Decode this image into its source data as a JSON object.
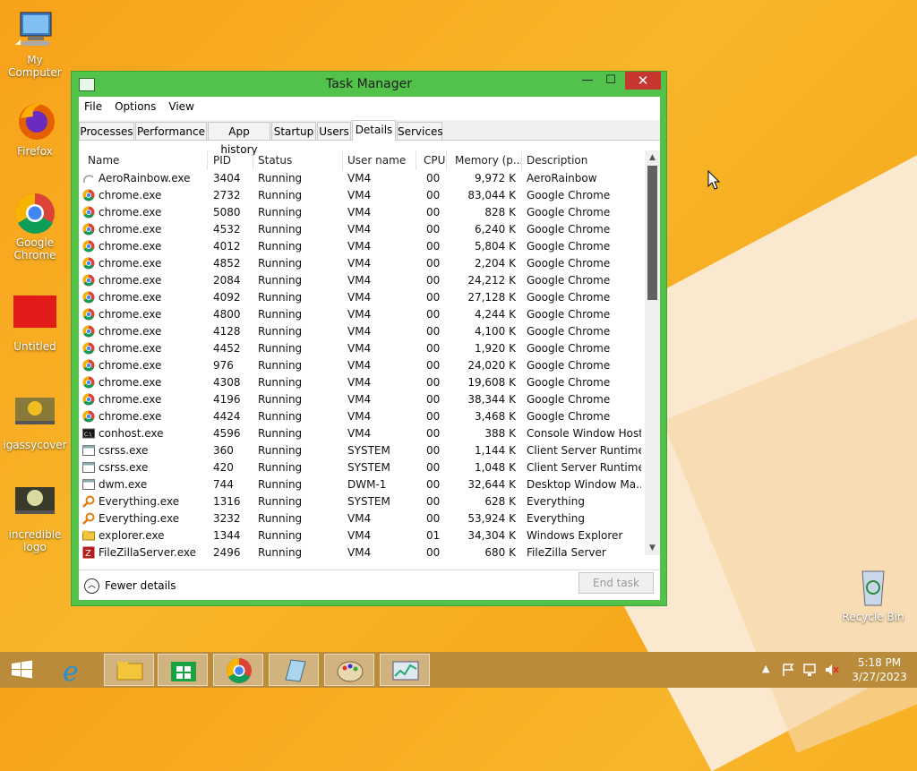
{
  "desktop": {
    "icons": [
      {
        "label": "My Computer",
        "icon": "computer-icon"
      },
      {
        "label": "Firefox",
        "icon": "firefox-icon"
      },
      {
        "label": "Google Chrome",
        "icon": "chrome-icon"
      },
      {
        "label": "Untitled",
        "icon": "red-image-icon"
      },
      {
        "label": "igassycover",
        "icon": "image-thumbnail-icon"
      },
      {
        "label": "incredible logo",
        "icon": "image-thumbnail-icon"
      },
      {
        "label": "Recycle Bin",
        "icon": "recycle-bin-icon"
      }
    ]
  },
  "window": {
    "title": "Task Manager",
    "min_glyph": "—",
    "max_glyph": "☐",
    "close_glyph": "✕",
    "menu": [
      "File",
      "Options",
      "View"
    ],
    "tabs": [
      "Processes",
      "Performance",
      "App history",
      "Startup",
      "Users",
      "Details",
      "Services"
    ],
    "active_tab": "Details",
    "columns": [
      "Name",
      "PID",
      "Status",
      "User name",
      "CPU",
      "Memory (p...",
      "Description"
    ],
    "sort_glyph": "^",
    "rows": [
      {
        "icon": "aero",
        "name": "AeroRainbow.exe",
        "pid": "3404",
        "status": "Running",
        "user": "VM4",
        "cpu": "00",
        "mem": "9,972 K",
        "desc": "AeroRainbow"
      },
      {
        "icon": "chrome",
        "name": "chrome.exe",
        "pid": "2732",
        "status": "Running",
        "user": "VM4",
        "cpu": "00",
        "mem": "83,044 K",
        "desc": "Google Chrome"
      },
      {
        "icon": "chrome",
        "name": "chrome.exe",
        "pid": "5080",
        "status": "Running",
        "user": "VM4",
        "cpu": "00",
        "mem": "828 K",
        "desc": "Google Chrome"
      },
      {
        "icon": "chrome",
        "name": "chrome.exe",
        "pid": "4532",
        "status": "Running",
        "user": "VM4",
        "cpu": "00",
        "mem": "6,240 K",
        "desc": "Google Chrome"
      },
      {
        "icon": "chrome",
        "name": "chrome.exe",
        "pid": "4012",
        "status": "Running",
        "user": "VM4",
        "cpu": "00",
        "mem": "5,804 K",
        "desc": "Google Chrome"
      },
      {
        "icon": "chrome",
        "name": "chrome.exe",
        "pid": "4852",
        "status": "Running",
        "user": "VM4",
        "cpu": "00",
        "mem": "2,204 K",
        "desc": "Google Chrome"
      },
      {
        "icon": "chrome",
        "name": "chrome.exe",
        "pid": "2084",
        "status": "Running",
        "user": "VM4",
        "cpu": "00",
        "mem": "24,212 K",
        "desc": "Google Chrome"
      },
      {
        "icon": "chrome",
        "name": "chrome.exe",
        "pid": "4092",
        "status": "Running",
        "user": "VM4",
        "cpu": "00",
        "mem": "27,128 K",
        "desc": "Google Chrome"
      },
      {
        "icon": "chrome",
        "name": "chrome.exe",
        "pid": "4800",
        "status": "Running",
        "user": "VM4",
        "cpu": "00",
        "mem": "4,244 K",
        "desc": "Google Chrome"
      },
      {
        "icon": "chrome",
        "name": "chrome.exe",
        "pid": "4128",
        "status": "Running",
        "user": "VM4",
        "cpu": "00",
        "mem": "4,100 K",
        "desc": "Google Chrome"
      },
      {
        "icon": "chrome",
        "name": "chrome.exe",
        "pid": "4452",
        "status": "Running",
        "user": "VM4",
        "cpu": "00",
        "mem": "1,920 K",
        "desc": "Google Chrome"
      },
      {
        "icon": "chrome",
        "name": "chrome.exe",
        "pid": "976",
        "status": "Running",
        "user": "VM4",
        "cpu": "00",
        "mem": "24,020 K",
        "desc": "Google Chrome"
      },
      {
        "icon": "chrome",
        "name": "chrome.exe",
        "pid": "4308",
        "status": "Running",
        "user": "VM4",
        "cpu": "00",
        "mem": "19,608 K",
        "desc": "Google Chrome"
      },
      {
        "icon": "chrome",
        "name": "chrome.exe",
        "pid": "4196",
        "status": "Running",
        "user": "VM4",
        "cpu": "00",
        "mem": "38,344 K",
        "desc": "Google Chrome"
      },
      {
        "icon": "chrome",
        "name": "chrome.exe",
        "pid": "4424",
        "status": "Running",
        "user": "VM4",
        "cpu": "00",
        "mem": "3,468 K",
        "desc": "Google Chrome"
      },
      {
        "icon": "console",
        "name": "conhost.exe",
        "pid": "4596",
        "status": "Running",
        "user": "VM4",
        "cpu": "00",
        "mem": "388 K",
        "desc": "Console Window Host"
      },
      {
        "icon": "window",
        "name": "csrss.exe",
        "pid": "360",
        "status": "Running",
        "user": "SYSTEM",
        "cpu": "00",
        "mem": "1,144 K",
        "desc": "Client Server Runtime..."
      },
      {
        "icon": "window",
        "name": "csrss.exe",
        "pid": "420",
        "status": "Running",
        "user": "SYSTEM",
        "cpu": "00",
        "mem": "1,048 K",
        "desc": "Client Server Runtime..."
      },
      {
        "icon": "window",
        "name": "dwm.exe",
        "pid": "744",
        "status": "Running",
        "user": "DWM-1",
        "cpu": "00",
        "mem": "32,644 K",
        "desc": "Desktop Window Ma..."
      },
      {
        "icon": "search",
        "name": "Everything.exe",
        "pid": "1316",
        "status": "Running",
        "user": "SYSTEM",
        "cpu": "00",
        "mem": "628 K",
        "desc": "Everything"
      },
      {
        "icon": "search",
        "name": "Everything.exe",
        "pid": "3232",
        "status": "Running",
        "user": "VM4",
        "cpu": "00",
        "mem": "53,924 K",
        "desc": "Everything"
      },
      {
        "icon": "explorer",
        "name": "explorer.exe",
        "pid": "1344",
        "status": "Running",
        "user": "VM4",
        "cpu": "01",
        "mem": "34,304 K",
        "desc": "Windows Explorer"
      },
      {
        "icon": "filezilla",
        "name": "FileZillaServer.exe",
        "pid": "2496",
        "status": "Running",
        "user": "VM4",
        "cpu": "00",
        "mem": "680 K",
        "desc": "FileZilla Server"
      }
    ],
    "fewer_details": "Fewer details",
    "end_task": "End task"
  },
  "taskbar": {
    "items": [
      "start-icon",
      "internet-explorer-icon",
      "file-explorer-icon",
      "store-icon",
      "chrome-icon",
      "notepad-icon",
      "paint-icon",
      "task-manager-icon"
    ],
    "time": "5:18 PM",
    "date": "3/27/2023"
  },
  "colors": {
    "window_frame": "#53c24a",
    "close_button": "#c7372f",
    "desktop": "#f7a21a",
    "taskbar": "#b98b3b"
  }
}
